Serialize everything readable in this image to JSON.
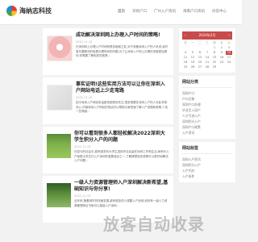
{
  "site": {
    "name": "海纳志科技"
  },
  "nav": [
    "首页",
    "深圳户口",
    "广州入户资讯",
    "海南户口资讯",
    "问答中心"
  ],
  "articles": [
    {
      "title": "成功解决深圳网上办理入户时间的策略!",
      "date": "2022-11-10",
      "summary": "在深圳网上办理入户时间有很多困难之处,对于准备深圳入户的人来说,我们首先要解决的就是办理时间的问题,为了让深圳入户网上办理的流程更加顺利,你需要了解相关的政策..."
    },
    {
      "title": "事实证明!这些实用方法可以让你在深圳入户网站电话上少走弯路",
      "date": "2022-11-10",
      "summary": "如今深圳入户网站电话越来越受到关注,很多想要在深圳入户的人对此非常关心,毕竟深圳入户网站的电话可以帮助大家快速了解入户流程和政策,少走一些弯路..."
    },
    {
      "title": "你可以看到很多人都轻松解决2022深圳大学生积分入户的问题",
      "date": "2022-11-10",
      "summary": "在如今的社会中,越来越多的大学生选择毕业后留在深圳工作和生活,而积分入户就是大学生们入户深圳的重要途径之一,了解清楚相关政策可以更好地解决入户问题..."
    },
    {
      "title": "一级人力资源管理师入户深圳解决新希望,基础知识与你分享!",
      "date": "2022-11-10",
      "summary": "近年来,随着城市的快速发展,越来越多的人想要入户深圳,而持有一级人力资源管理师证书就可以直接入户深圳..."
    }
  ],
  "calendar": {
    "header": "2024年2月",
    "weekdays": [
      "日",
      "一",
      "二",
      "三",
      "四",
      "五",
      "六"
    ],
    "days": [
      "",
      "",
      "",
      "",
      "1",
      "2",
      "3",
      "4",
      "5",
      "6",
      "7",
      "8",
      "9",
      "10",
      "11",
      "12",
      "13",
      "14",
      "15",
      "16",
      "17",
      "18",
      "19",
      "20",
      "21",
      "22",
      "23",
      "24",
      "25",
      "26",
      "27",
      "28",
      "29",
      "",
      ""
    ],
    "today": "10"
  },
  "categories": {
    "title": "网站分类",
    "items": [
      "深圳户口",
      "户口迁移",
      "深圳户口办理",
      "毕业生入深户",
      "人才引进入户",
      "深圳积分入户",
      "深圳户口政策",
      "入户资讯"
    ]
  },
  "links": {
    "title": "网站标签",
    "items": [
      "深圳入户资讯",
      "深圳积分入户",
      "入户代办",
      "入户条件"
    ]
  },
  "watermark": "放客自动收录"
}
